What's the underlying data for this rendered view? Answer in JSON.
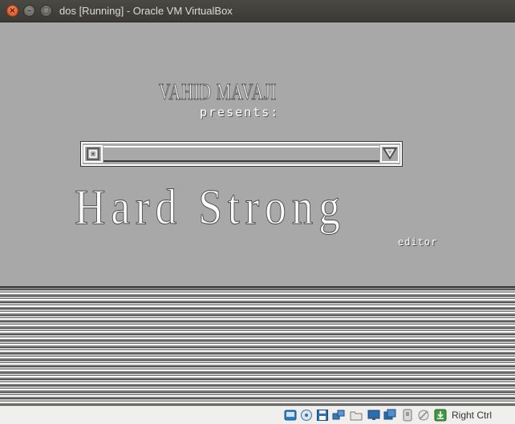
{
  "window": {
    "title": "dos [Running] - Oracle VM VirtualBox",
    "close_glyph": "×",
    "min_glyph": "–",
    "max_glyph": "□"
  },
  "guest": {
    "author": "VAHID MAVAJI",
    "presents": "presents:",
    "app_name": "Hard Strong",
    "app_subtitle": "editor",
    "progress_fraction": 0
  },
  "statusbar": {
    "icons": [
      "hard-disk-icon",
      "optical-drive-icon",
      "floppy-icon",
      "network-icon",
      "shared-folders-icon",
      "display-icon",
      "video-capture-icon",
      "usb-icon",
      "mouse-integration-icon",
      "keyboard-capture-icon"
    ],
    "host_key": "Right Ctrl"
  },
  "colors": {
    "guest_bg": "#a8a8a8",
    "titlebar": "#3c3b37",
    "close_button": "#e05a26",
    "statusbar_bg": "#f0efed"
  }
}
